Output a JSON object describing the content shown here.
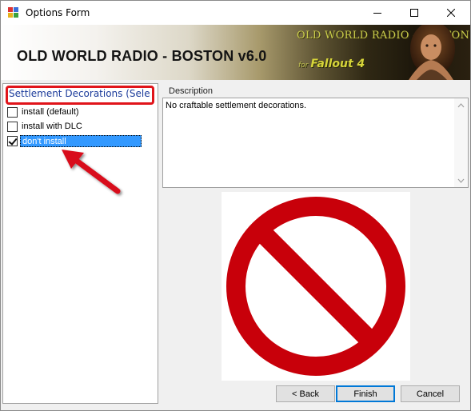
{
  "window": {
    "title": "Options Form",
    "minimize_icon": "minimize-icon",
    "maximize_icon": "maximize-icon",
    "close_icon": "close-icon"
  },
  "banner": {
    "title": "OLD WORLD RADIO - BOSTON v6.0",
    "logo_text": "OLD WORLD RADIO - BOSTON",
    "game_prefix": "for",
    "game_text": "Fallout 4"
  },
  "options": {
    "group_header": "Settlement Decorations (Selec...",
    "items": [
      {
        "label": "install (default)",
        "checked": false,
        "selected": false
      },
      {
        "label": "install with DLC",
        "checked": false,
        "selected": false
      },
      {
        "label": "don't install",
        "checked": true,
        "selected": true
      }
    ]
  },
  "description": {
    "label": "Description",
    "text": "No craftable settlement decorations."
  },
  "preview": {
    "icon": "prohibited-icon",
    "color": "#c8000a"
  },
  "buttons": {
    "back": "< Back",
    "finish": "Finish",
    "cancel": "Cancel"
  },
  "annotation": {
    "highlight_color": "#e0141a",
    "arrow_color": "#d8101a"
  }
}
